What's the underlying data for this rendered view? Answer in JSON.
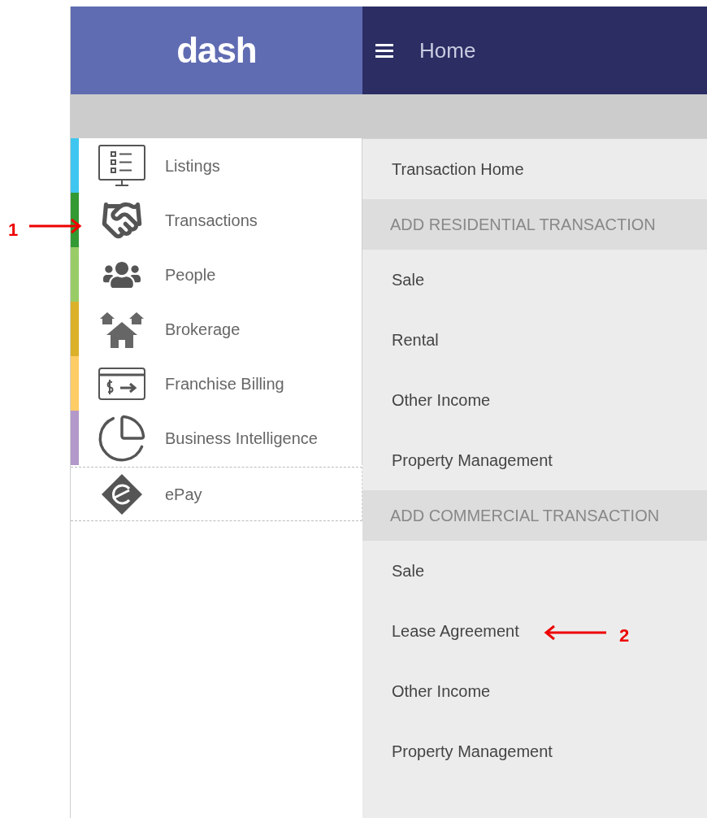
{
  "header": {
    "logo": "dash",
    "title": "Home"
  },
  "sidebar": {
    "items": [
      {
        "label": "Listings",
        "color": "#3ec6f0"
      },
      {
        "label": "Transactions",
        "color": "#339933"
      },
      {
        "label": "People",
        "color": "#99cc66"
      },
      {
        "label": "Brokerage",
        "color": "#dbb12a"
      },
      {
        "label": "Franchise Billing",
        "color": "#ffcc66"
      },
      {
        "label": "Business Intelligence",
        "color": "#b399c9"
      },
      {
        "label": "ePay"
      }
    ]
  },
  "submenu": {
    "items": [
      {
        "kind": "link",
        "label": "Transaction Home"
      },
      {
        "kind": "header",
        "label": "ADD RESIDENTIAL TRANSACTION"
      },
      {
        "kind": "link",
        "label": "Sale"
      },
      {
        "kind": "link",
        "label": "Rental"
      },
      {
        "kind": "link",
        "label": "Other Income"
      },
      {
        "kind": "link",
        "label": "Property Management"
      },
      {
        "kind": "header",
        "label": "ADD COMMERCIAL TRANSACTION"
      },
      {
        "kind": "link",
        "label": "Sale"
      },
      {
        "kind": "link",
        "label": "Lease Agreement"
      },
      {
        "kind": "link",
        "label": "Other Income"
      },
      {
        "kind": "link",
        "label": "Property Management"
      }
    ]
  },
  "annotations": [
    {
      "label": "1"
    },
    {
      "label": "2"
    }
  ]
}
